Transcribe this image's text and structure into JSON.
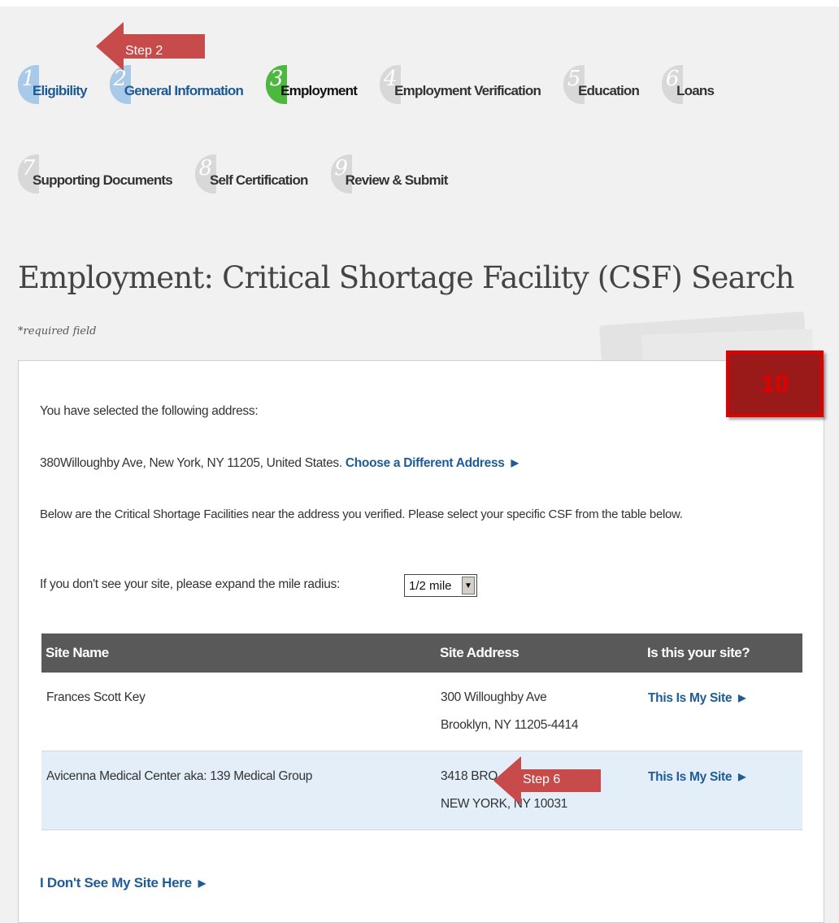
{
  "steps": [
    {
      "num": "1",
      "label": "Eligibility",
      "state": "done"
    },
    {
      "num": "2",
      "label": "General Information",
      "state": "done"
    },
    {
      "num": "3",
      "label": "Employment",
      "state": "current"
    },
    {
      "num": "4",
      "label": "Employment Verification",
      "state": "todo"
    },
    {
      "num": "5",
      "label": "Education",
      "state": "todo"
    },
    {
      "num": "6",
      "label": "Loans",
      "state": "todo"
    },
    {
      "num": "7",
      "label": "Supporting Documents",
      "state": "todo"
    },
    {
      "num": "8",
      "label": "Self Certification",
      "state": "todo"
    },
    {
      "num": "9",
      "label": "Review & Submit",
      "state": "todo"
    }
  ],
  "page": {
    "title": "Employment: Critical Shortage Facility (CSF) Search",
    "required_note": "*required field"
  },
  "panel": {
    "selected_intro": "You have selected the following address:",
    "selected_address": "380Willoughby Ave, New York, NY 11205, United States.",
    "choose_link": "Choose a Different Address",
    "below_text": "Below are the Critical Shortage Facilities near the address you verified. Please select your specific CSF from the table below.",
    "radius_label": "If you don't see your site, please expand the mile radius:",
    "radius_value": "1/2 mile",
    "table_headers": [
      "Site Name",
      "Site Address",
      "Is this your site?"
    ],
    "rows": [
      {
        "name": "Frances Scott Key",
        "addr1": "300 Willoughby Ave",
        "addr2": "Brooklyn, NY 11205-4414",
        "action": "This Is My Site"
      },
      {
        "name": "Avicenna Medical Center aka: 139 Medical Group",
        "addr1": "3418 BRO",
        "addr2": "NEW YORK, NY 10031",
        "action": "This Is My Site"
      }
    ],
    "not_here_link": "I Don't See My Site Here"
  },
  "annotations": {
    "step2_label": "Step 2",
    "step6_label": "Step 6",
    "badge_number": "10",
    "accent_color": "#c84b4b",
    "badge_color": "#e00000"
  }
}
